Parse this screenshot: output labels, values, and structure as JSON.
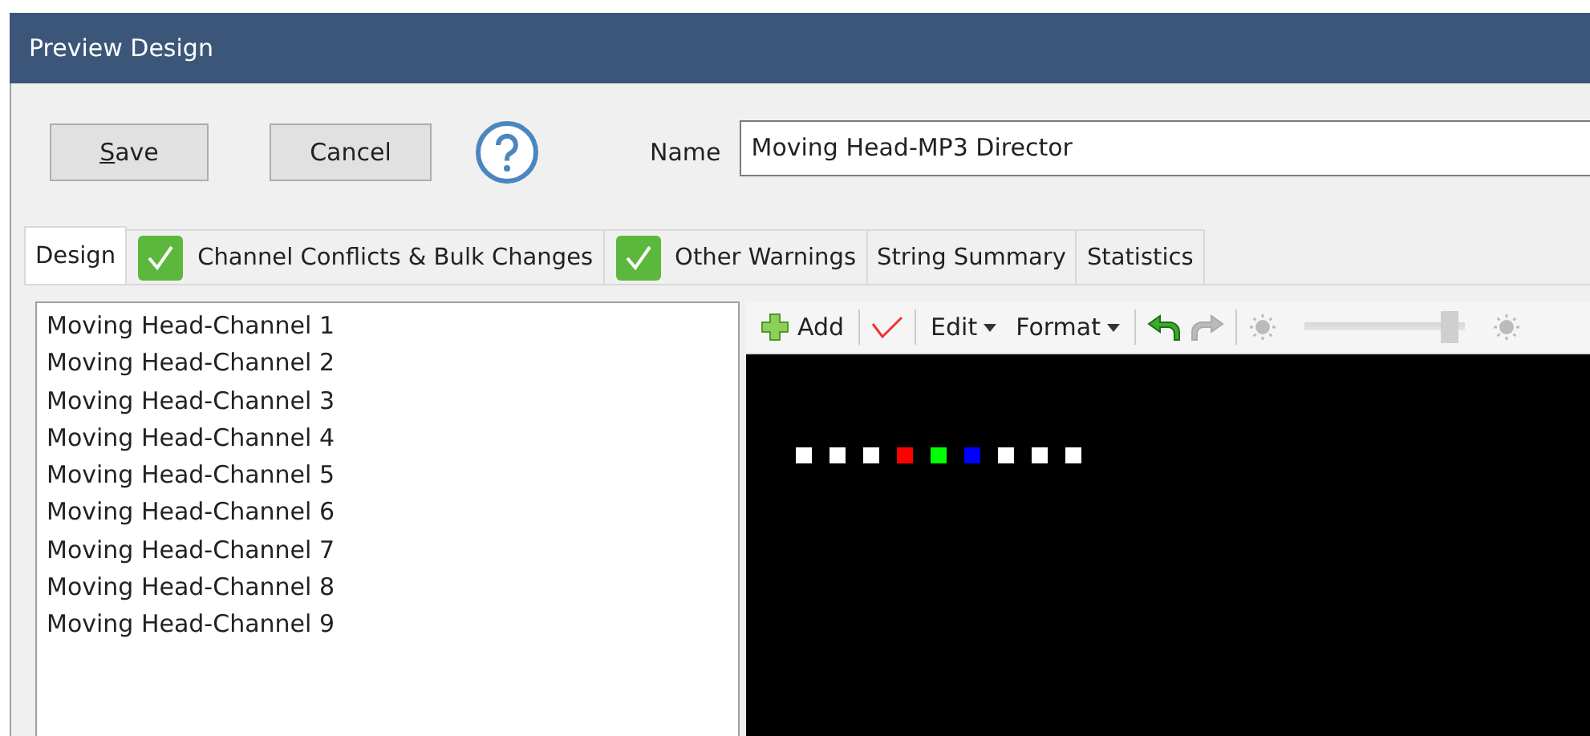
{
  "window": {
    "title": "Preview Design"
  },
  "buttons": [
    {
      "label": "Save",
      "first_letter_underlined": true
    },
    {
      "label": "Cancel",
      "first_letter_underlined": false
    }
  ],
  "name_field": {
    "label": "Name",
    "value": "Moving Head-MP3 Director"
  },
  "tabs": [
    {
      "label": "Design",
      "selected": true,
      "ok": false
    },
    {
      "label": "Channel Conflicts & Bulk Changes",
      "selected": false,
      "ok": true
    },
    {
      "label": "Other Warnings",
      "selected": false,
      "ok": true
    },
    {
      "label": "String Summary",
      "selected": false,
      "ok": false
    },
    {
      "label": "Statistics",
      "selected": false,
      "ok": false
    }
  ],
  "channels": [
    "Moving Head-Channel 1",
    "Moving Head-Channel 2",
    "Moving Head-Channel 3",
    "Moving Head-Channel 4",
    "Moving Head-Channel 5",
    "Moving Head-Channel 6",
    "Moving Head-Channel 7",
    "Moving Head-Channel 8",
    "Moving Head-Channel 9"
  ],
  "toolbar": {
    "add": "Add",
    "edit": "Edit",
    "format": "Format",
    "undo_disabled": false,
    "redo_disabled": true,
    "brightness": {
      "level": 0.95,
      "disabled": true
    }
  },
  "preview_lights": [
    {
      "color": "#ffffff"
    },
    {
      "color": "#ffffff"
    },
    {
      "color": "#ffffff"
    },
    {
      "color": "#ff0000"
    },
    {
      "color": "#00ff00"
    },
    {
      "color": "#0000ff"
    },
    {
      "color": "#ffffff"
    },
    {
      "color": "#ffffff"
    },
    {
      "color": "#ffffff"
    }
  ]
}
